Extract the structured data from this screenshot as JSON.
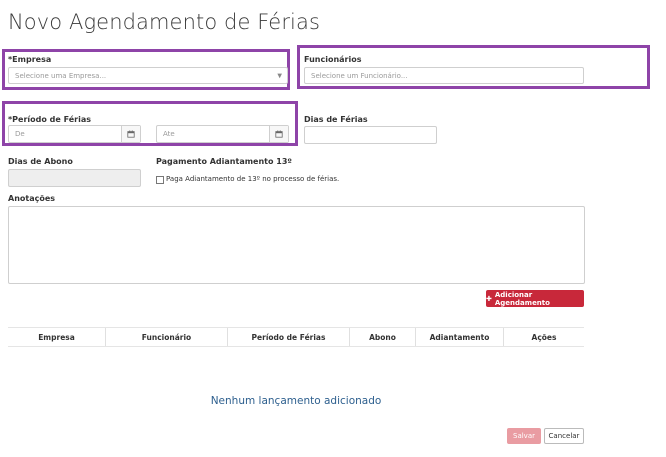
{
  "page": {
    "title": "Novo Agendamento de Férias"
  },
  "empresa": {
    "label": "*Empresa",
    "placeholder": "Selecione uma Empresa..."
  },
  "funcionarios": {
    "label": "Funcionários",
    "placeholder": "Selecione um Funcionário..."
  },
  "periodo": {
    "label": "*Período de Férias",
    "from_placeholder": "De",
    "to_placeholder": "Ate"
  },
  "dias_ferias": {
    "label": "Dias de Férias",
    "value": ""
  },
  "dias_abono": {
    "label": "Dias de Abono",
    "value": ""
  },
  "adiantamento": {
    "label": "Pagamento Adiantamento 13º",
    "checkbox_label": "Paga Adiantamento de 13º no processo de férias.",
    "checked": false
  },
  "anotacoes": {
    "label": "Anotações",
    "value": ""
  },
  "add_button": {
    "label": "Adicionar Agendamento",
    "icon": "plus-icon"
  },
  "table": {
    "columns": [
      "Empresa",
      "Funcionário",
      "Período de Férias",
      "Abono",
      "Adiantamento",
      "Ações"
    ],
    "empty_message": "Nenhum lançamento adicionado"
  },
  "footer": {
    "save_label": "Salvar",
    "cancel_label": "Cancelar"
  },
  "colors": {
    "highlight": "#8e44a8",
    "primary": "#c8283a",
    "save_disabled": "#e99ca2",
    "link": "#2d5f8e"
  }
}
